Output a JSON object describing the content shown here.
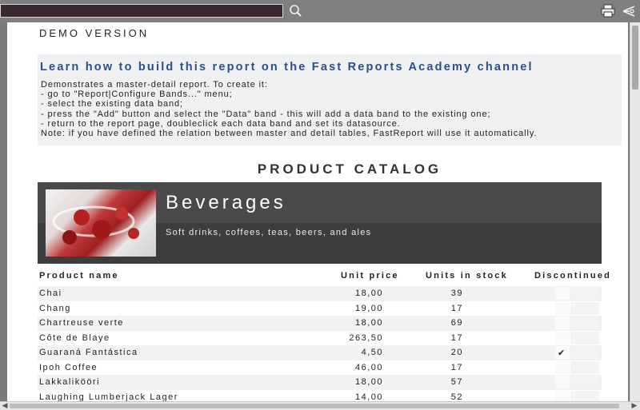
{
  "header": {
    "search_value": "",
    "search_icon": "magnifier-icon",
    "print_icon": "printer-icon",
    "export_icon": "export-icon"
  },
  "report": {
    "demo_label": "DEMO VERSION",
    "learn_link": "Learn how to build this report on the Fast Reports Academy channel",
    "description": "Demonstrates a master-detail report. To create it:\n- go to \"Report|Configure Bands...\" menu;\n- select the existing data band;\n- press the \"Add\" button and select the \"Data\" band - this will add a data band to the existing one;\n- return to the report page, doubleclick each data band and set its datasource.\nNote: if you have defined the relation between master and detail tables, FastReport will use it automatically.",
    "catalog_title": "PRODUCT CATALOG",
    "category": {
      "name": "Beverages",
      "description": "Soft drinks, coffees, teas, beers, and ales"
    },
    "columns": {
      "name": "Product name",
      "price": "Unit price",
      "stock": "Units in stock",
      "discontinued": "Discontinued"
    },
    "products": [
      {
        "name": "Chai",
        "price": "18,00",
        "stock": "39",
        "discontinued": ""
      },
      {
        "name": "Chang",
        "price": "19,00",
        "stock": "17",
        "discontinued": ""
      },
      {
        "name": "Chartreuse verte",
        "price": "18,00",
        "stock": "69",
        "discontinued": ""
      },
      {
        "name": "Côte de Blaye",
        "price": "263,50",
        "stock": "17",
        "discontinued": ""
      },
      {
        "name": "Guaraná Fantástica",
        "price": "4,50",
        "stock": "20",
        "discontinued": "✔"
      },
      {
        "name": "Ipoh Coffee",
        "price": "46,00",
        "stock": "17",
        "discontinued": ""
      },
      {
        "name": "Lakkalikööri",
        "price": "18,00",
        "stock": "57",
        "discontinued": ""
      },
      {
        "name": "Laughing Lumberjack Lager",
        "price": "14,00",
        "stock": "52",
        "discontinued": ""
      }
    ]
  },
  "colors": {
    "accent": "#2a4f8f",
    "banner": "#4a4a4a"
  }
}
